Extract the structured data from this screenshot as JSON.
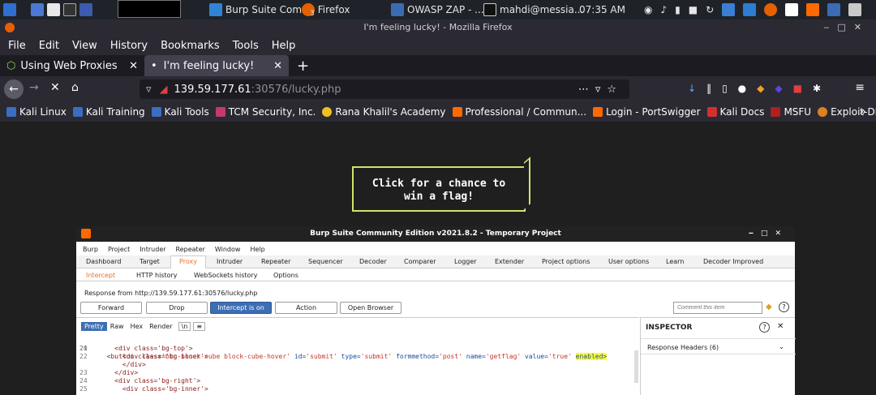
{
  "taskbar": {
    "burp_label": "Burp Suite Com...",
    "burp_badge": "",
    "firefox_label": "Firefox",
    "firefox_badge": "3",
    "zap_label": "OWASP ZAP - ...",
    "terminal_label": "mahdi@messia...",
    "time": "07:35 AM"
  },
  "window": {
    "title": "I'm feeling lucky! - Mozilla Firefox"
  },
  "menu": [
    "File",
    "Edit",
    "View",
    "History",
    "Bookmarks",
    "Tools",
    "Help"
  ],
  "tabs": [
    {
      "label": "Using Web Proxies"
    },
    {
      "label": "I'm feeling lucky!"
    }
  ],
  "url": {
    "host": "139.59.177.61",
    "port": ":30576",
    "path": "/lucky.php"
  },
  "bookmarks": [
    "Kali Linux",
    "Kali Training",
    "Kali Tools",
    "TCM Security, Inc.",
    "Rana Khalil's Academy",
    "Professional / Commun...",
    "Login - PortSwigger",
    "Kali Docs",
    "MSFU",
    "Exploit-DB"
  ],
  "page": {
    "line1": "Click for a chance to",
    "line2": "win a flag!"
  },
  "burp": {
    "title": "Burp Suite Community Edition v2021.8.2 - Temporary Project",
    "menu": [
      "Burp",
      "Project",
      "Intruder",
      "Repeater",
      "Window",
      "Help"
    ],
    "tabs": [
      "Dashboard",
      "Target",
      "Proxy",
      "Intruder",
      "Repeater",
      "Sequencer",
      "Decoder",
      "Comparer",
      "Logger",
      "Extender",
      "Project options",
      "User options",
      "Learn",
      "Decoder Improved"
    ],
    "subtabs": [
      "Intercept",
      "HTTP history",
      "WebSockets history",
      "Options"
    ],
    "response_from": "Response from http://139.59.177.61:30576/lucky.php",
    "buttons": {
      "forward": "Forward",
      "drop": "Drop",
      "intercept": "Intercept is on",
      "action": "Action",
      "open_browser": "Open Browser"
    },
    "comment_placeholder": "Comment this item",
    "view_tabs": [
      "Pretty",
      "Raw",
      "Hex",
      "Render",
      "\\n",
      "≡"
    ],
    "inspector": {
      "title": "INSPECTOR",
      "section": "Response Headers (6)"
    },
    "code": [
      {
        "n": "20",
        "pre": "  <button class=",
        "v1": "'btn block-cube block-cube-hover'",
        "a2": " id=",
        "v2": "'submit'",
        "a3": " type=",
        "v3": "'submit'",
        "a4": " formmethod=",
        "v4": "'post'",
        "a5": " name=",
        "v5": "'getflag'",
        "a6": " value=",
        "v6": "'true'",
        "hl": "enabled>"
      },
      {
        "n": "21",
        "text": "    <div class='bg-top'>"
      },
      {
        "n": "22",
        "text": "      <div class='bg-inner'>"
      },
      {
        "n": "",
        "text": "      </div>"
      },
      {
        "n": "23",
        "text": "    </div>"
      },
      {
        "n": "24",
        "text": "    <div class='bg-right'>"
      },
      {
        "n": "25",
        "text": "      <div class='bg-inner'>"
      }
    ]
  }
}
